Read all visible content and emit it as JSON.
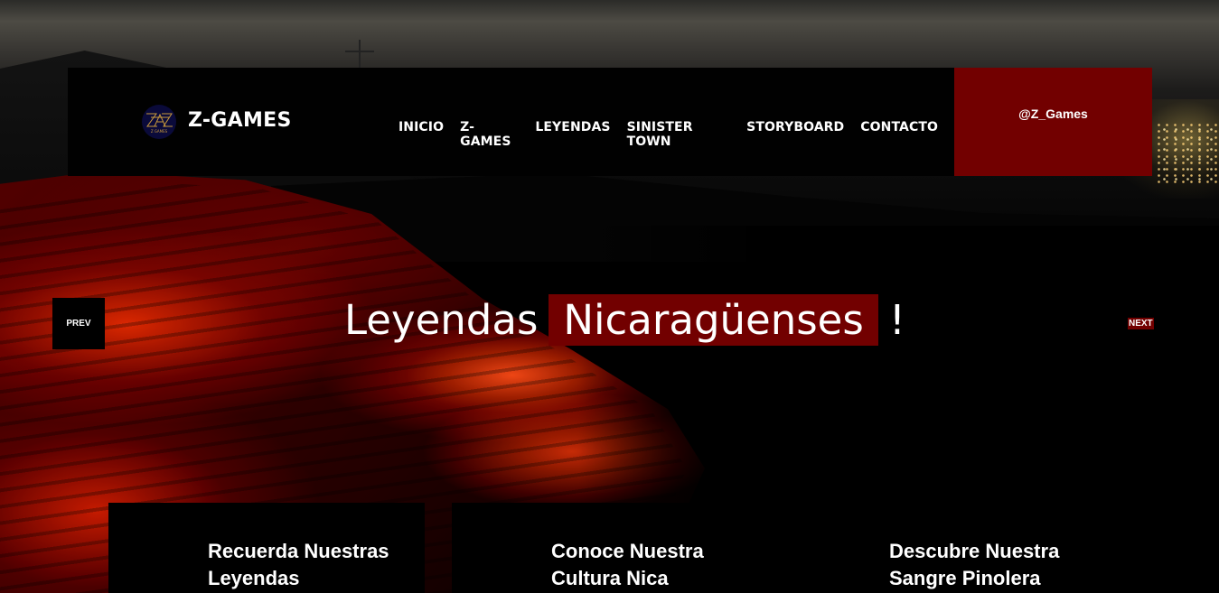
{
  "header": {
    "logo_text": "Z-GAMES",
    "logo_mark_text": "Z GAMES",
    "nav": [
      {
        "label": "INICIO"
      },
      {
        "label": "Z-GAMES"
      },
      {
        "label": "LEYENDAS"
      },
      {
        "label": "SINISTER TOWN"
      },
      {
        "label": "STORYBOARD"
      },
      {
        "label": "CONTACTO"
      }
    ],
    "social_handle": "@Z_Games"
  },
  "hero": {
    "title_before": "Leyendas",
    "title_highlight": "Nicaragüenses",
    "title_after": "!",
    "prev_label": "PREV",
    "next_label": "NEXT"
  },
  "cards": [
    {
      "title": "Recuerda Nuestras Leyendas"
    },
    {
      "title": "Conoce Nuestra Cultura Nica"
    },
    {
      "title": "Descubre Nuestra Sangre Pinolera"
    }
  ],
  "colors": {
    "accent": "#720000",
    "header_bg": "#010101",
    "text": "#ffffff"
  }
}
